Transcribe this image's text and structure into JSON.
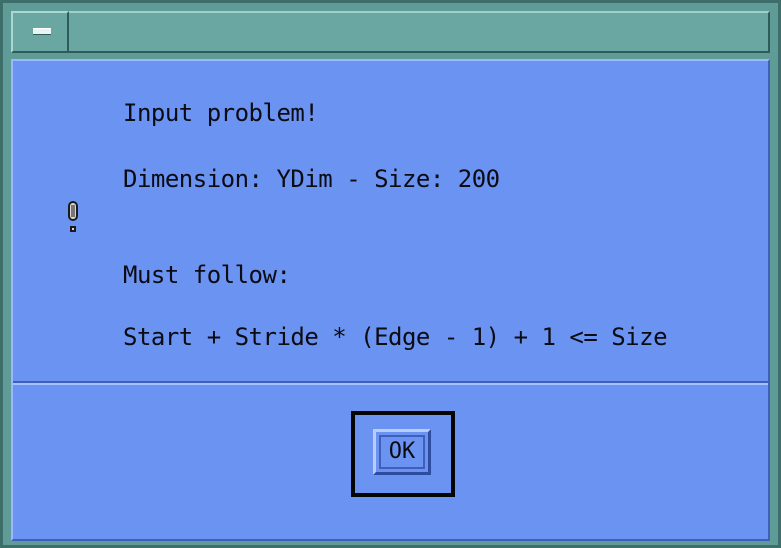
{
  "dialog": {
    "message": {
      "line1": "Input problem!",
      "line2": "Dimension: YDim - Size: 200",
      "line3": "Must follow:",
      "line4": "Start + Stride * (Edge - 1) + 1 <= Size"
    },
    "icon": "exclamation-icon",
    "buttons": {
      "ok_label": "OK"
    }
  },
  "window": {
    "menu_icon": "window-menu-icon"
  },
  "colors": {
    "dialog_bg": "#6b93f2",
    "frame": "#5f9c97",
    "text": "#0b0b13"
  }
}
